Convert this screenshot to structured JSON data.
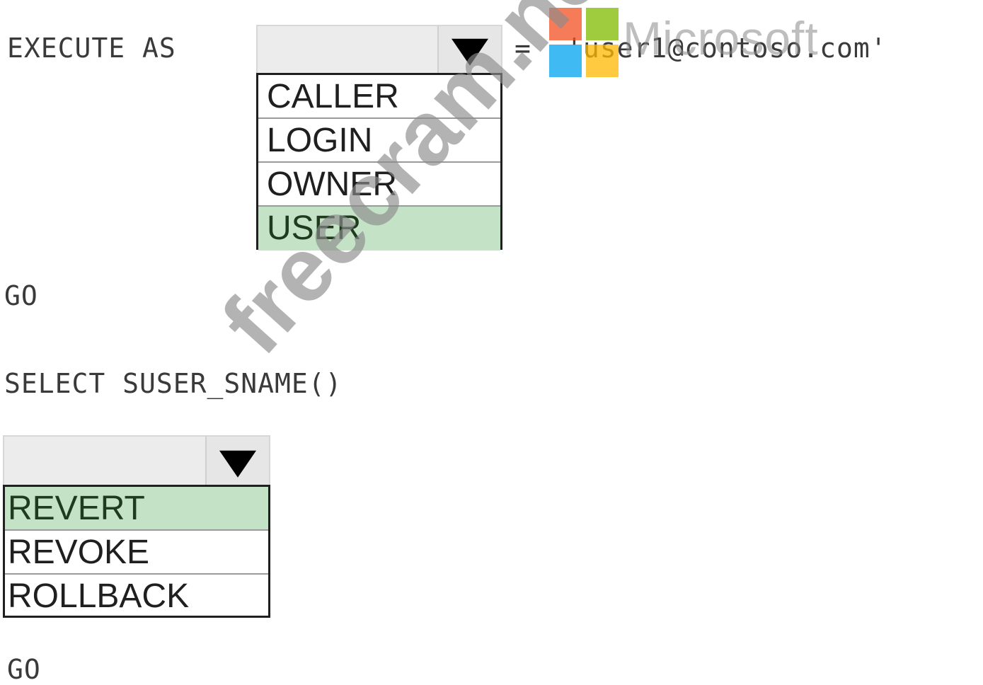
{
  "stmt1": {
    "execute_as": "EXECUTE AS",
    "equals": "=",
    "literal": "'user1@contoso.com'"
  },
  "dropdown1": {
    "selected": "",
    "options": [
      "CALLER",
      "LOGIN",
      "OWNER",
      "USER"
    ],
    "highlighted": "USER"
  },
  "go1": "GO",
  "select_stmt": "SELECT SUSER_SNAME()",
  "dropdown2": {
    "selected": "",
    "options": [
      "REVERT",
      "REVOKE",
      "ROLLBACK"
    ],
    "highlighted": "REVERT"
  },
  "go2": "GO",
  "overlay": {
    "logo_text": "Microsoft",
    "watermark": "freecram.net",
    "logo_colors": [
      "#f25022",
      "#7fba00",
      "#00a4ef",
      "#ffb900"
    ]
  },
  "colors": {
    "selected_option": "#c4e2c6",
    "dropdown_bg": "#ececec"
  }
}
